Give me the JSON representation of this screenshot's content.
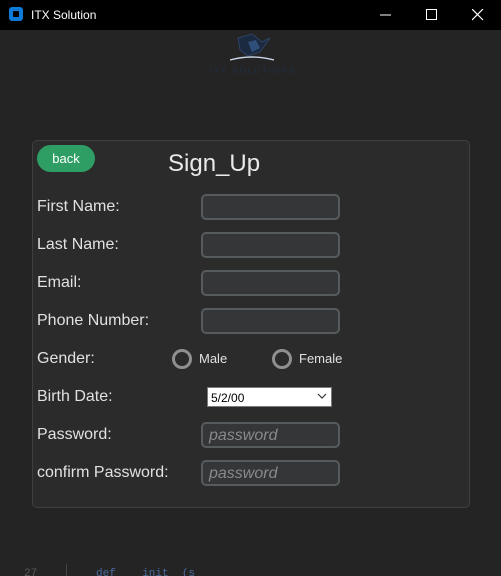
{
  "window": {
    "title": "ITX Solution"
  },
  "logo": {
    "text": "ITX SOLUTIONS"
  },
  "form": {
    "back_label": "back",
    "title": "Sign_Up",
    "fields": {
      "first_name": {
        "label": "First Name:"
      },
      "last_name": {
        "label": "Last Name:"
      },
      "email": {
        "label": "Email:"
      },
      "phone": {
        "label": "Phone Number:"
      },
      "password": {
        "label": "Password:",
        "placeholder": "password"
      },
      "confirm_password": {
        "label": "confirm Password:",
        "placeholder": "password"
      }
    },
    "gender": {
      "label": "Gender:",
      "options": [
        "Male",
        "Female"
      ]
    },
    "birth_date": {
      "label": "Birth Date:",
      "value": "5/2/00"
    }
  },
  "background_code": {
    "line_number": "27",
    "text": "def  __init__(s"
  },
  "colors": {
    "accent": "#2f9e64",
    "window_bg": "#242424",
    "card_bg": "#2b2b2b"
  }
}
